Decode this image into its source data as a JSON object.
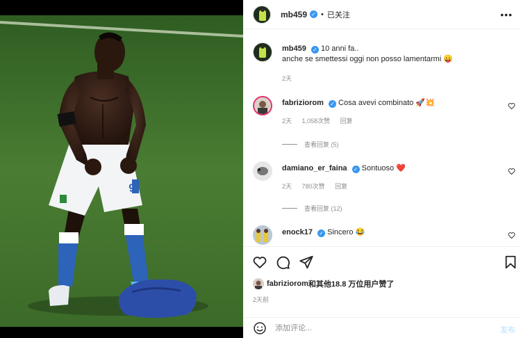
{
  "post": {
    "author": "mb459",
    "follow_status": "已关注",
    "more_label": "•••"
  },
  "caption": {
    "author": "mb459",
    "text_line1": "10 anni fa..",
    "text_line2": "anche se smettessi oggi non posso lamentarmi 😛",
    "time": "2天"
  },
  "comments": [
    {
      "user": "fabriziorom",
      "text": "Cosa avevi combinato 🚀💥",
      "time": "2天",
      "likes": "1,058次赞",
      "reply_label": "回复",
      "view_replies": "查看回复 (5)"
    },
    {
      "user": "damiano_er_faina",
      "text": "Sontuoso ❤️",
      "time": "2天",
      "likes": "780次赞",
      "reply_label": "回复",
      "view_replies": "查看回复 (12)"
    },
    {
      "user": "enock17",
      "text": "Sincero 😂"
    }
  ],
  "likes": {
    "user": "fabriziorom",
    "text": "和其他18.8 万位用户赞了"
  },
  "date": "2天前",
  "add_comment": {
    "placeholder": "添加评论...",
    "post_label": "发布"
  },
  "icons": [
    "verified-icon",
    "more-icon",
    "heart-icon",
    "comment-icon",
    "share-icon",
    "bookmark-icon",
    "emoji-icon"
  ],
  "colors": {
    "verified": "#3897f0",
    "muted": "#8e8e8e",
    "post_button": "#b2dffc",
    "pitch": "#3b6a2a"
  }
}
